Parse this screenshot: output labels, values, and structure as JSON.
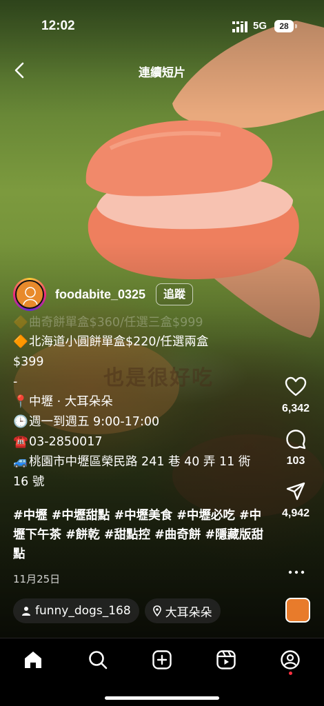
{
  "status": {
    "time": "12:02",
    "network": "5G",
    "battery": "28"
  },
  "nav": {
    "title": "連續短片"
  },
  "author": {
    "username": "foodabite_0325",
    "follow_label": "追蹤"
  },
  "caption": {
    "line_faded": "曲奇餅單盒$360/任選三盒$999",
    "line1_icon": "🔶",
    "line1": "北海道小圓餅單盒$220/任選兩盒",
    "line2": "$399",
    "line3": "-",
    "place_icon": "📍",
    "place": "中壢 · 大耳朵朵",
    "hours_icon": "🕒",
    "hours": "週一到週五 9:00-17:00",
    "phone_icon": "☎️",
    "phone": "03-2850017",
    "address_icon": "🚙",
    "address": "桃園市中壢區榮民路 241 巷 40 弄 11 衖 16 號",
    "hashtags": "#中壢 #中壢甜點 #中壢美食 #中壢必吃 #中壢下午茶 #餅乾 #甜點控 #曲奇餅 #隱藏版甜點",
    "date": "11月25日"
  },
  "video_overlay_text": "也是很好吃",
  "actions": {
    "likes": "6,342",
    "comments": "103",
    "shares": "4,942"
  },
  "chips": {
    "collab_user": "funny_dogs_168",
    "location": "大耳朵朵"
  },
  "colors": {
    "background": "#000000",
    "notification_dot": "#ff3040",
    "macaron": "#f2936b"
  }
}
